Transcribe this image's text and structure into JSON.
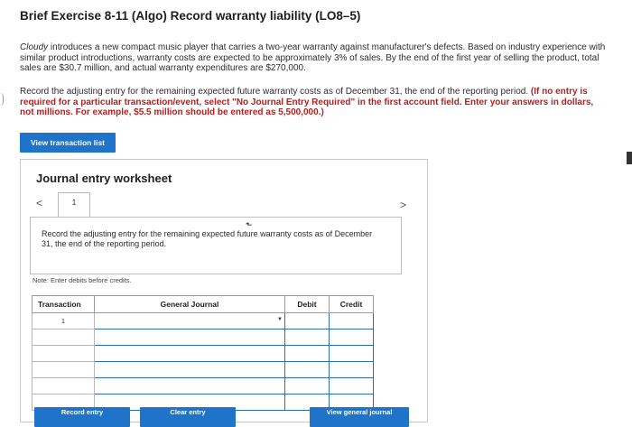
{
  "header": {
    "title": "Brief Exercise 8-11 (Algo) Record warranty liability (LO8–5)"
  },
  "problem": {
    "company": "Cloudy",
    "paragraph1_rest": " introduces a new compact music player that carries a two-year warranty against manufacturer's defects. Based on industry experience with similar product introductions, warranty costs are expected to be approximately 3% of sales. By the end of the first year of selling the product, total sales are $30.7 million, and actual warranty expenditures are $270,000.",
    "paragraph2_plain": "Record the adjusting entry for the remaining expected future warranty costs as of December 31, the end of the reporting period. ",
    "paragraph2_bold": "(If no entry is required for a particular transaction/event, select \"No Journal Entry Required\" in the first account field. Enter your answers in dollars, not millions. For example, $5.5 million should be entered as 5,500,000.)"
  },
  "buttons": {
    "view_transaction_list": "View transaction list",
    "record_entry": "Record entry",
    "clear_entry": "Clear entry",
    "view_general_journal": "View general journal"
  },
  "worksheet": {
    "title": "Journal entry worksheet",
    "prev_arrow": "<",
    "next_arrow": ">",
    "tab_number": "1",
    "instruction": "Record the adjusting entry for the remaining expected future warranty costs as of December 31, the end of the reporting period.",
    "note": "Note: Enter debits before credits."
  },
  "journal_table": {
    "headers": {
      "transaction": "Transaction",
      "general_journal": "General Journal",
      "debit": "Debit",
      "credit": "Credit"
    },
    "rows": [
      {
        "transaction": "1",
        "account": "",
        "debit": "",
        "credit": ""
      },
      {
        "transaction": "",
        "account": "",
        "debit": "",
        "credit": ""
      },
      {
        "transaction": "",
        "account": "",
        "debit": "",
        "credit": ""
      },
      {
        "transaction": "",
        "account": "",
        "debit": "",
        "credit": ""
      },
      {
        "transaction": "",
        "account": "",
        "debit": "",
        "credit": ""
      },
      {
        "transaction": "",
        "account": "",
        "debit": "",
        "credit": ""
      }
    ]
  },
  "colors": {
    "button_blue": "#1f73c8",
    "input_border_blue": "#2c6fb8",
    "emphasis_red": "#b51f1f"
  }
}
